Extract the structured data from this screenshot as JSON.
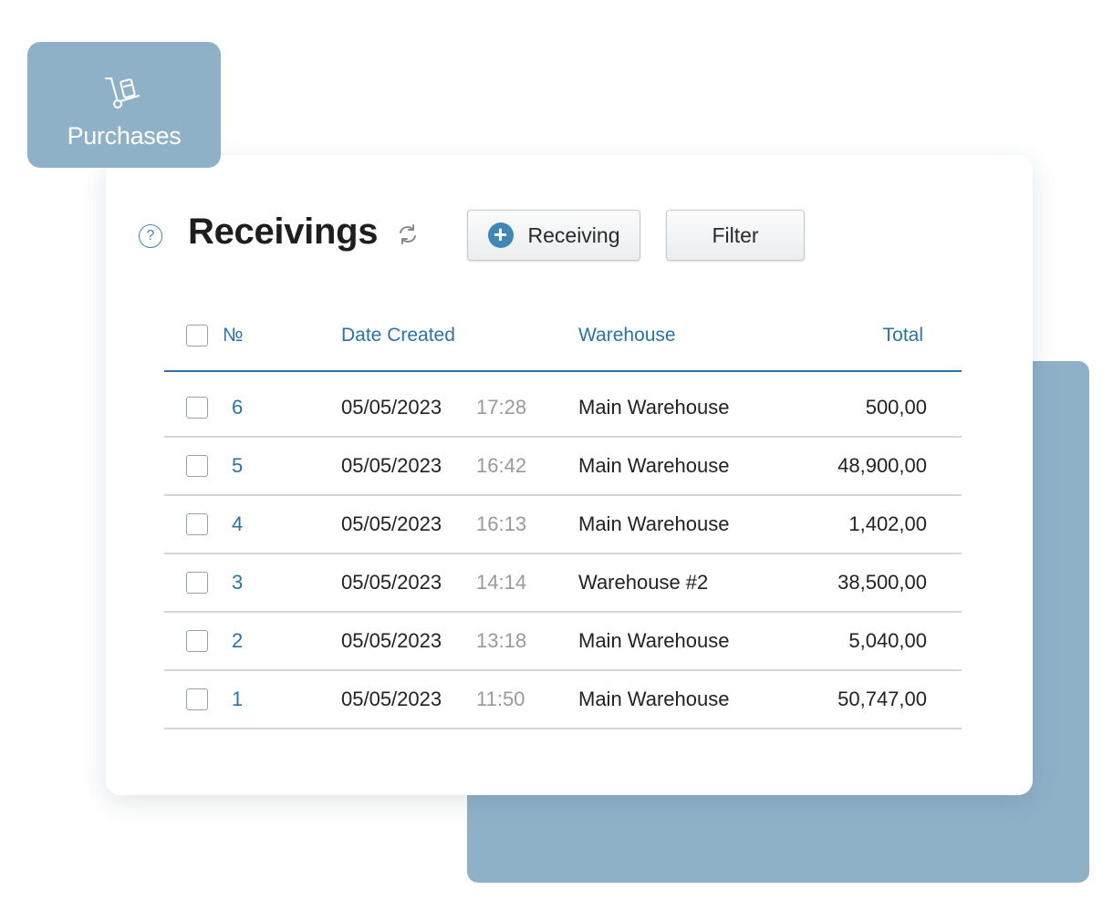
{
  "nav": {
    "tab_label": "Purchases",
    "tab_icon": "hand-truck-icon"
  },
  "header": {
    "title": "Receivings",
    "add_button_label": "Receiving",
    "filter_button_label": "Filter"
  },
  "table": {
    "columns": {
      "number": "№",
      "date_created": "Date Created",
      "warehouse": "Warehouse",
      "total": "Total"
    },
    "rows": [
      {
        "number": "6",
        "date": "05/05/2023",
        "time": "17:28",
        "warehouse": "Main Warehouse",
        "total": "500,00"
      },
      {
        "number": "5",
        "date": "05/05/2023",
        "time": "16:42",
        "warehouse": "Main Warehouse",
        "total": "48,900,00"
      },
      {
        "number": "4",
        "date": "05/05/2023",
        "time": "16:13",
        "warehouse": "Main Warehouse",
        "total": "1,402,00"
      },
      {
        "number": "3",
        "date": "05/05/2023",
        "time": "14:14",
        "warehouse": "Warehouse #2",
        "total": "38,500,00"
      },
      {
        "number": "2",
        "date": "05/05/2023",
        "time": "13:18",
        "warehouse": "Main Warehouse",
        "total": "5,040,00"
      },
      {
        "number": "1",
        "date": "05/05/2023",
        "time": "11:50",
        "warehouse": "Main Warehouse",
        "total": "50,747,00"
      }
    ]
  },
  "colors": {
    "accent": "#2a73a8",
    "panel": "#8fb1c8",
    "muted_text": "#999999"
  }
}
